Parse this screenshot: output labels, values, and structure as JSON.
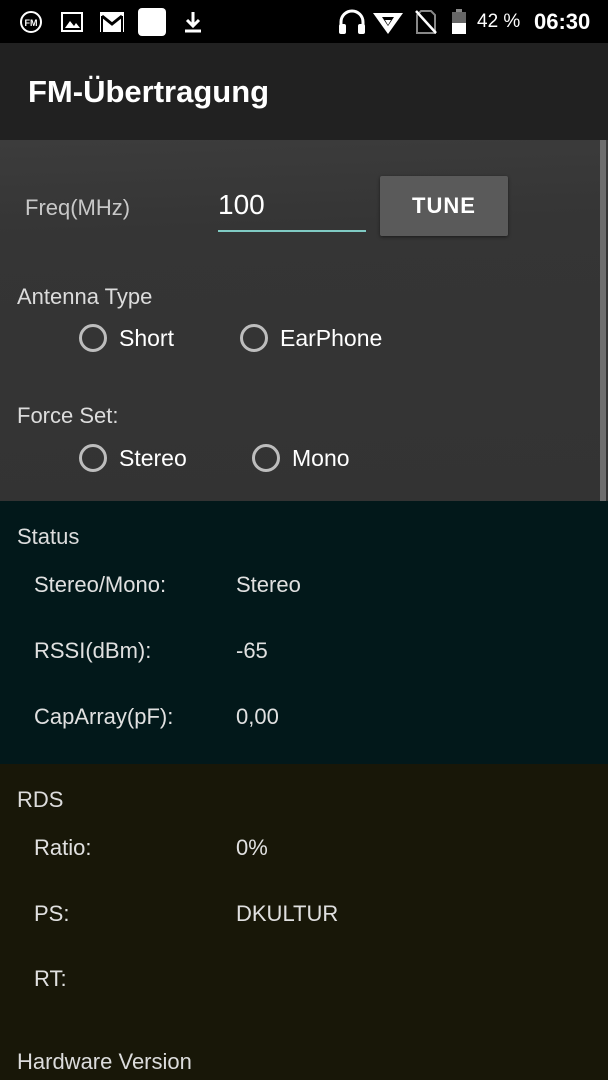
{
  "status_bar": {
    "battery_percent": "42 %",
    "time": "06:30",
    "notification_icons": [
      "fm-radio-icon",
      "image-icon",
      "gmail-icon",
      "blank-app-icon",
      "download-icon"
    ],
    "system_icons": [
      "headset-icon",
      "wifi-icon",
      "no-sim-icon",
      "battery-icon"
    ]
  },
  "app_bar": {
    "title": "FM-Übertragung"
  },
  "controls": {
    "freq_label": "Freq(MHz)",
    "freq_value": "100",
    "tune_label": "TUNE",
    "antenna_label": "Antenna Type",
    "antenna_options": [
      "Short",
      "EarPhone"
    ],
    "force_label": "Force Set:",
    "force_options": [
      "Stereo",
      "Mono"
    ]
  },
  "status": {
    "title": "Status",
    "rows": [
      {
        "key": "Stereo/Mono:",
        "value": "Stereo"
      },
      {
        "key": "RSSI(dBm):",
        "value": "-65"
      },
      {
        "key": "CapArray(pF):",
        "value": "0,00"
      }
    ]
  },
  "rds": {
    "title": "RDS",
    "rows": [
      {
        "key": "Ratio:",
        "value": "0%"
      },
      {
        "key": "PS:",
        "value": "DKULTUR"
      },
      {
        "key": "RT:",
        "value": ""
      }
    ]
  },
  "hardware": {
    "title": "Hardware Version"
  },
  "colors": {
    "accent_underline": "#80cbc4",
    "status_bg": "#02181a",
    "rds_bg": "#181708",
    "controls_bg": "#333333"
  }
}
